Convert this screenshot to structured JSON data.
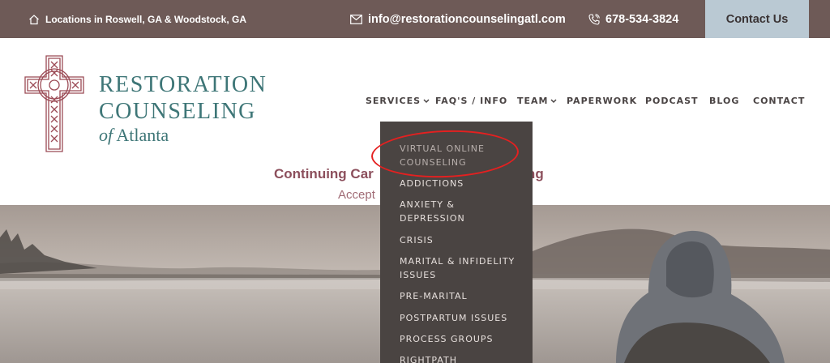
{
  "topbar": {
    "location": "Locations in Roswell, GA & Woodstock, GA",
    "email": "info@restorationcounselingatl.com",
    "phone": "678-534-3824",
    "contact_button": "Contact Us"
  },
  "logo": {
    "line1": "RESTORATION",
    "line2": "COUNSELING",
    "line3_prefix": "of",
    "line3_rest": "Atlanta"
  },
  "nav": {
    "items": [
      "SERVICES",
      "FAQ'S / INFO",
      "TEAM",
      "PAPERWORK",
      "PODCAST",
      "BLOG",
      "CONTACT"
    ]
  },
  "tagline": {
    "line1_left": "Continuing Car",
    "line1_right": "lling",
    "line2": "Accept"
  },
  "dropdown": {
    "items": [
      "VIRTUAL ONLINE COUNSELING",
      "ADDICTIONS",
      "ANXIETY & DEPRESSION",
      "CRISIS",
      "MARITAL & INFIDELITY ISSUES",
      "PRE-MARITAL",
      "POSTPARTUM ISSUES",
      "PROCESS GROUPS",
      "RIGHTPATH"
    ]
  },
  "colors": {
    "topbar": "#6e5a57",
    "contact_button": "#bac9d3",
    "logo_teal": "#3e7677",
    "logo_cross": "#9b4a55",
    "dropdown_bg": "#4a4442",
    "tagline": "#8c4f5c",
    "annotation_ring": "#e42020"
  }
}
